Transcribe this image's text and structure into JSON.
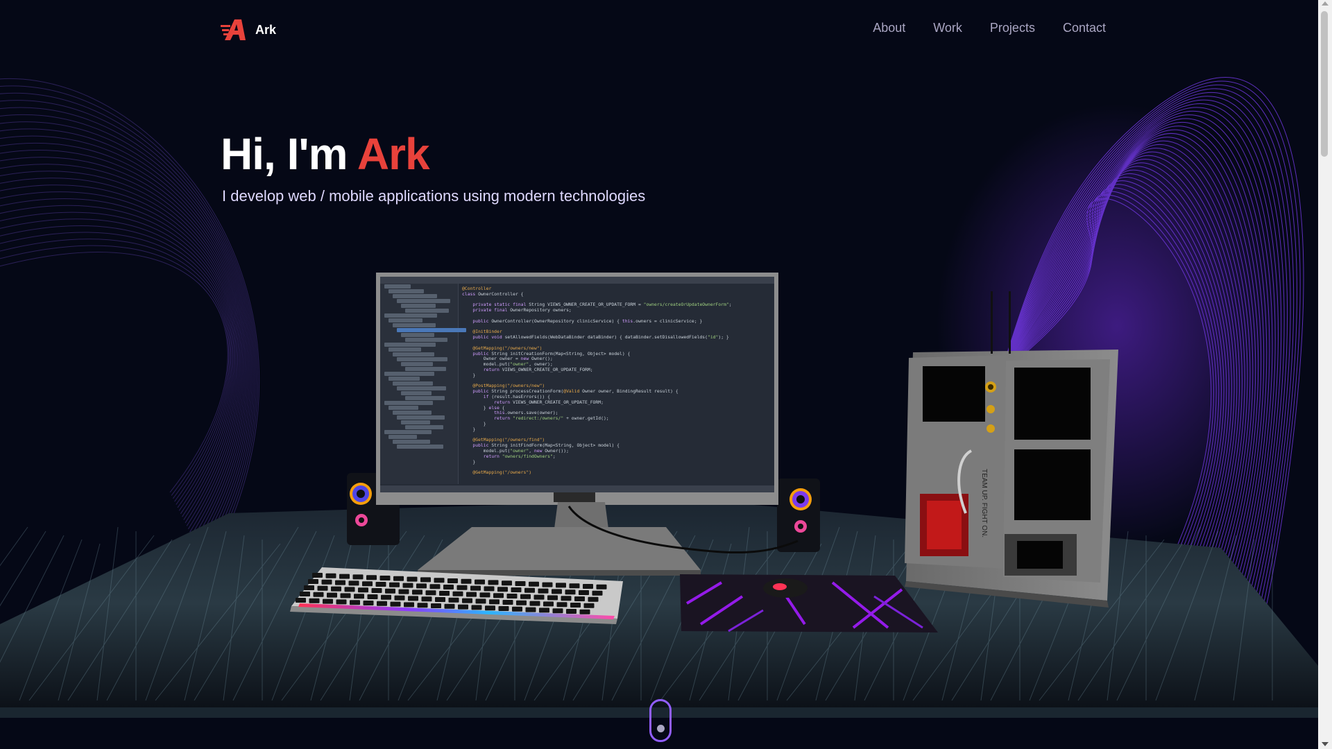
{
  "nav": {
    "brand_name": "Ark",
    "links": [
      "About",
      "Work",
      "Projects",
      "Contact"
    ]
  },
  "hero": {
    "greeting": "Hi, I'm ",
    "name": "Ark",
    "subtitle": "I develop web / mobile applications using modern technologies"
  },
  "scene": {
    "case_text": "TEAM UP. FIGHT ON."
  },
  "colors": {
    "background": "#050816",
    "accent": "#e8423b",
    "secondary_text": "#aaa6c3",
    "scroll_indicator_border": "#915eff"
  },
  "icons": {
    "brand": "brand-logo-icon",
    "scroll": "scroll-down-indicator-icon"
  }
}
